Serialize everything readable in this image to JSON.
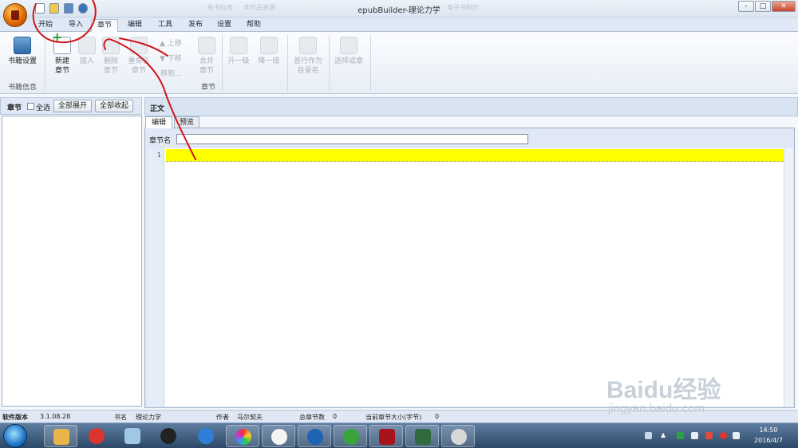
{
  "window": {
    "title": "epubBuilder-理论力学",
    "faded_tabs": [
      "新书标签",
      "本作品来源",
      "电子书制作"
    ],
    "controls": [
      "-",
      "□",
      "✕"
    ]
  },
  "ribbon_tabs": [
    "开始",
    "导入",
    "章节",
    "编辑",
    "工具",
    "发布",
    "设置",
    "帮助"
  ],
  "active_tab": "章节",
  "ribbon": {
    "book_settings": "书籍设置",
    "book_info_group": "书籍信息",
    "new_line1": "新建",
    "new_line2": "章节",
    "insert": "插入",
    "delete_line1": "删除",
    "delete_line2": "章节",
    "rename_line1": "重命名",
    "rename_line2": "章节",
    "move_up": "上移",
    "move_down": "下移",
    "move_to": "移到...",
    "merge_line1": "合并",
    "merge_line2": "章节",
    "chapter_group": "章节",
    "promote": "升一级",
    "demote": "降一级",
    "first_line_title1": "首行作为",
    "first_line_title2": "目录名",
    "select_chapter": "选择成章"
  },
  "left_panel": {
    "title": "章节",
    "select_all": "全选",
    "expand_all": "全部展开",
    "collapse_all": "全部收起"
  },
  "right_panel": {
    "title": "正文",
    "tab_edit": "编辑",
    "tab_preview": "预览",
    "chapter_name_label": "章节名",
    "chapter_name_value": "",
    "line_number": "1"
  },
  "status": {
    "version_label": "软件版本",
    "version": "3.1.08.28",
    "book_label": "书名",
    "book": "理论力学",
    "author_label": "作者",
    "author": "马尔契夫",
    "total_label": "总章节数",
    "total": "0",
    "size_label": "当前章节大小(字节)",
    "size": "0"
  },
  "taskbar": {
    "time": "14:50",
    "date": "2016/4/7"
  },
  "watermark": {
    "brand": "Baidu经验",
    "site": "jingyan.baidu.com"
  },
  "colors": {
    "highlight_line": "#ffff00",
    "annotation": "#d0141b"
  }
}
